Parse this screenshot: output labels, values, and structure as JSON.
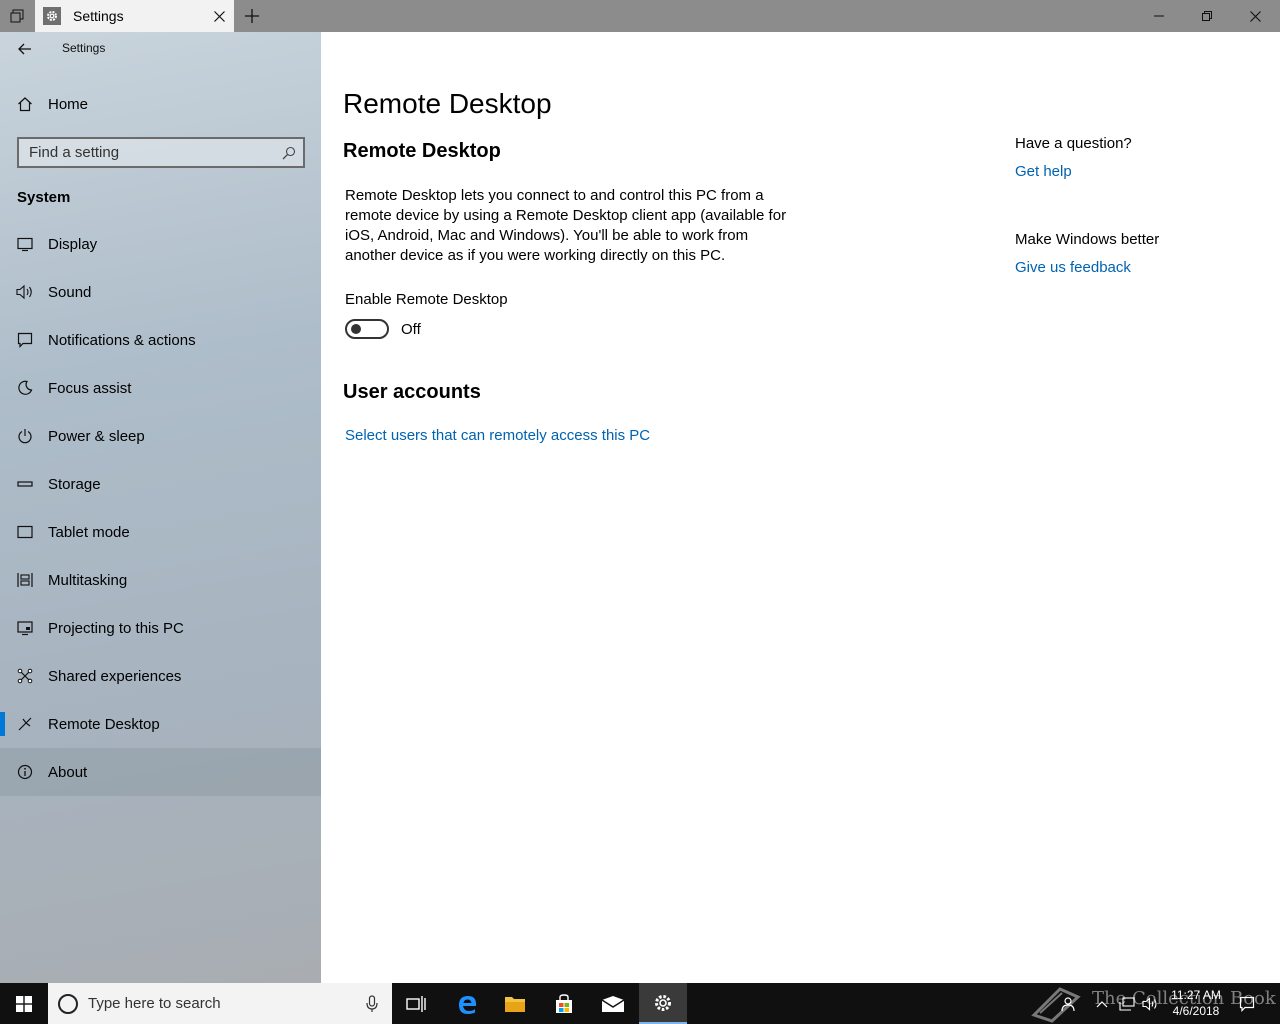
{
  "window": {
    "tab_title": "Settings",
    "app_title": "Settings"
  },
  "sidebar": {
    "home_label": "Home",
    "search_placeholder": "Find a setting",
    "section_label": "System",
    "items": [
      {
        "label": "Display",
        "icon": "display-icon"
      },
      {
        "label": "Sound",
        "icon": "sound-icon"
      },
      {
        "label": "Notifications & actions",
        "icon": "notifications-icon"
      },
      {
        "label": "Focus assist",
        "icon": "focus-assist-icon"
      },
      {
        "label": "Power & sleep",
        "icon": "power-icon"
      },
      {
        "label": "Storage",
        "icon": "storage-icon"
      },
      {
        "label": "Tablet mode",
        "icon": "tablet-mode-icon"
      },
      {
        "label": "Multitasking",
        "icon": "multitasking-icon"
      },
      {
        "label": "Projecting to this PC",
        "icon": "projecting-icon"
      },
      {
        "label": "Shared experiences",
        "icon": "shared-experiences-icon"
      },
      {
        "label": "Remote Desktop",
        "icon": "remote-desktop-icon"
      },
      {
        "label": "About",
        "icon": "info-icon"
      }
    ],
    "selected": "Remote Desktop"
  },
  "main": {
    "page_title": "Remote Desktop",
    "section_title": "Remote Desktop",
    "description": "Remote Desktop lets you connect to and control this PC from a remote device by using a Remote Desktop client app (available for iOS, Android, Mac and Windows). You'll be able to work from another device as if you were working directly on this PC.",
    "toggle_label": "Enable Remote Desktop",
    "toggle_state": "Off",
    "user_accounts_title": "User accounts",
    "user_accounts_link": "Select users that can remotely access this PC",
    "help": {
      "question": "Have a question?",
      "get_help": "Get help",
      "make_better": "Make Windows better",
      "feedback": "Give us feedback"
    }
  },
  "taskbar": {
    "search_placeholder": "Type here to search",
    "time": "11:27 AM",
    "date": "4/6/2018",
    "watermark": "The Collection Book"
  },
  "colors": {
    "accent": "#0078d7",
    "link": "#0063b1",
    "taskbar": "#101010"
  }
}
